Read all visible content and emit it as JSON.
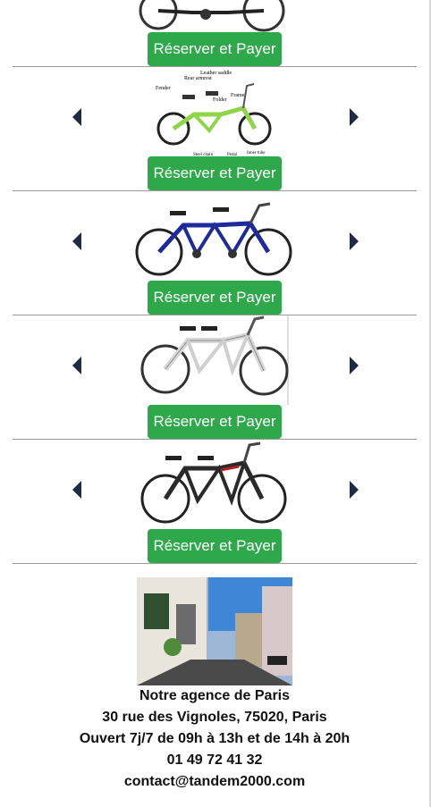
{
  "listing": {
    "button_label": "Réserver et Payer",
    "items": [
      {
        "name": "bike-1",
        "image": "black-tandem-bike"
      },
      {
        "name": "bike-2",
        "image": "green-folding-tandem-diagram",
        "labels": [
          "Leather saddle",
          "Rear armrest",
          "Fender",
          "Frame",
          "Folder",
          "Steel chain",
          "Pedal",
          "Inner tube"
        ]
      },
      {
        "name": "bike-3",
        "image": "blue-tandem-bike"
      },
      {
        "name": "bike-4",
        "image": "white-tandem-bike"
      },
      {
        "name": "bike-5",
        "image": "black-red-tandem-bike"
      }
    ]
  },
  "agency": {
    "title": "Notre agence de Paris",
    "address": "30 rue des Vignoles, 75020, Paris",
    "hours": "Ouvert 7j/7 de 09h à 13h et de 14h à 20h",
    "phone": "01 49 72 41 32",
    "email": "contact@tandem2000.com"
  },
  "colors": {
    "button": "#2ea84b",
    "divider": "#9a9a9a",
    "arrow": "#1f2a44"
  }
}
